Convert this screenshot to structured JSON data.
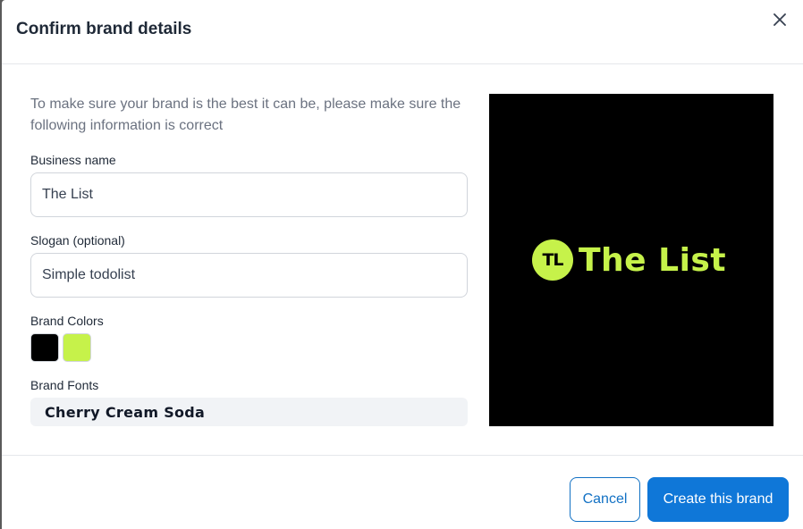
{
  "dialog": {
    "title": "Confirm brand details",
    "close_icon": "close-icon",
    "intro": "To make sure your brand is the best it can be, please make sure the following information is correct"
  },
  "form": {
    "business_name": {
      "label": "Business name",
      "value": "The List"
    },
    "slogan": {
      "label": "Slogan (optional)",
      "value": "Simple todolist"
    },
    "brand_colors": {
      "label": "Brand Colors",
      "colors": [
        "#000000",
        "#c6f24a"
      ]
    },
    "brand_fonts": {
      "label": "Brand Fonts",
      "font_name": "Cherry Cream Soda"
    }
  },
  "preview": {
    "badge_text": "TL",
    "logo_text": "The List",
    "background": "#000000",
    "accent": "#c6f24a"
  },
  "footer": {
    "cancel_label": "Cancel",
    "create_label": "Create this brand",
    "primary_color": "#0f77d8"
  }
}
